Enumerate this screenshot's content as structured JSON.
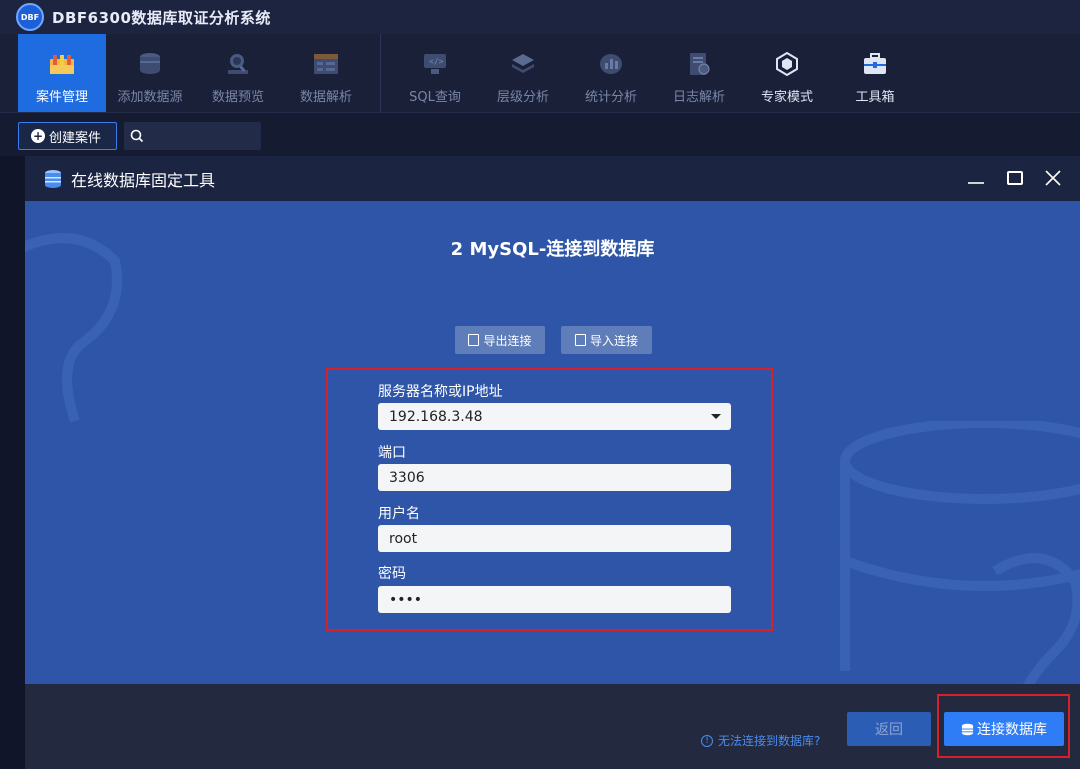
{
  "app": {
    "logo_text": "DBF",
    "title": "DBF6300数据库取证分析系统"
  },
  "toolbar": {
    "items": [
      {
        "label": "案件管理",
        "icon": "case-management-icon"
      },
      {
        "label": "添加数据源",
        "icon": "add-datasource-icon"
      },
      {
        "label": "数据预览",
        "icon": "data-preview-icon"
      },
      {
        "label": "数据解析",
        "icon": "data-parse-icon"
      },
      {
        "label": "SQL查询",
        "icon": "sql-query-icon"
      },
      {
        "label": "层级分析",
        "icon": "layer-analysis-icon"
      },
      {
        "label": "统计分析",
        "icon": "statistics-icon"
      },
      {
        "label": "日志解析",
        "icon": "log-parse-icon"
      },
      {
        "label": "专家模式",
        "icon": "expert-mode-icon"
      },
      {
        "label": "工具箱",
        "icon": "toolbox-icon"
      }
    ]
  },
  "subbar": {
    "create_case": "创建案件",
    "search_value": ""
  },
  "dialog": {
    "title": "在线数据库固定工具",
    "step_title": "2 MySQL-连接到数据库",
    "export_button": "导出连接",
    "import_button": "导入连接",
    "fields": {
      "server_label": "服务器名称或IP地址",
      "server_value": "192.168.3.48",
      "port_label": "端口",
      "port_value": "3306",
      "username_label": "用户名",
      "username_value": "root",
      "password_label": "密码",
      "password_value": "••••"
    },
    "footer": {
      "help_link": "无法连接到数据库?",
      "back_button": "返回",
      "connect_button": "连接数据库"
    }
  },
  "colors": {
    "accent": "#2e7cf6",
    "active_tab": "#1f6be0",
    "dialog_body": "#2e55a8",
    "highlight_border": "#d8202a"
  }
}
